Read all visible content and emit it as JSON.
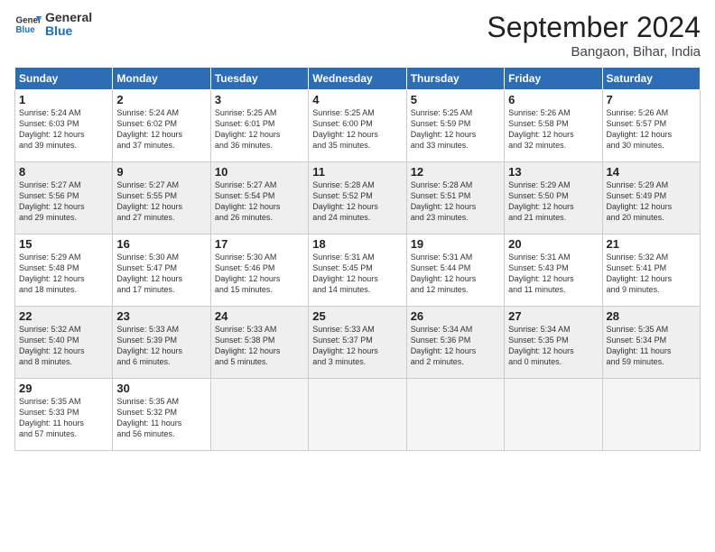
{
  "header": {
    "logo_line1": "General",
    "logo_line2": "Blue",
    "title": "September 2024",
    "location": "Bangaon, Bihar, India"
  },
  "weekdays": [
    "Sunday",
    "Monday",
    "Tuesday",
    "Wednesday",
    "Thursday",
    "Friday",
    "Saturday"
  ],
  "weeks": [
    [
      {
        "day": "1",
        "lines": [
          "Sunrise: 5:24 AM",
          "Sunset: 6:03 PM",
          "Daylight: 12 hours",
          "and 39 minutes."
        ]
      },
      {
        "day": "2",
        "lines": [
          "Sunrise: 5:24 AM",
          "Sunset: 6:02 PM",
          "Daylight: 12 hours",
          "and 37 minutes."
        ]
      },
      {
        "day": "3",
        "lines": [
          "Sunrise: 5:25 AM",
          "Sunset: 6:01 PM",
          "Daylight: 12 hours",
          "and 36 minutes."
        ]
      },
      {
        "day": "4",
        "lines": [
          "Sunrise: 5:25 AM",
          "Sunset: 6:00 PM",
          "Daylight: 12 hours",
          "and 35 minutes."
        ]
      },
      {
        "day": "5",
        "lines": [
          "Sunrise: 5:25 AM",
          "Sunset: 5:59 PM",
          "Daylight: 12 hours",
          "and 33 minutes."
        ]
      },
      {
        "day": "6",
        "lines": [
          "Sunrise: 5:26 AM",
          "Sunset: 5:58 PM",
          "Daylight: 12 hours",
          "and 32 minutes."
        ]
      },
      {
        "day": "7",
        "lines": [
          "Sunrise: 5:26 AM",
          "Sunset: 5:57 PM",
          "Daylight: 12 hours",
          "and 30 minutes."
        ]
      }
    ],
    [
      {
        "day": "8",
        "lines": [
          "Sunrise: 5:27 AM",
          "Sunset: 5:56 PM",
          "Daylight: 12 hours",
          "and 29 minutes."
        ]
      },
      {
        "day": "9",
        "lines": [
          "Sunrise: 5:27 AM",
          "Sunset: 5:55 PM",
          "Daylight: 12 hours",
          "and 27 minutes."
        ]
      },
      {
        "day": "10",
        "lines": [
          "Sunrise: 5:27 AM",
          "Sunset: 5:54 PM",
          "Daylight: 12 hours",
          "and 26 minutes."
        ]
      },
      {
        "day": "11",
        "lines": [
          "Sunrise: 5:28 AM",
          "Sunset: 5:52 PM",
          "Daylight: 12 hours",
          "and 24 minutes."
        ]
      },
      {
        "day": "12",
        "lines": [
          "Sunrise: 5:28 AM",
          "Sunset: 5:51 PM",
          "Daylight: 12 hours",
          "and 23 minutes."
        ]
      },
      {
        "day": "13",
        "lines": [
          "Sunrise: 5:29 AM",
          "Sunset: 5:50 PM",
          "Daylight: 12 hours",
          "and 21 minutes."
        ]
      },
      {
        "day": "14",
        "lines": [
          "Sunrise: 5:29 AM",
          "Sunset: 5:49 PM",
          "Daylight: 12 hours",
          "and 20 minutes."
        ]
      }
    ],
    [
      {
        "day": "15",
        "lines": [
          "Sunrise: 5:29 AM",
          "Sunset: 5:48 PM",
          "Daylight: 12 hours",
          "and 18 minutes."
        ]
      },
      {
        "day": "16",
        "lines": [
          "Sunrise: 5:30 AM",
          "Sunset: 5:47 PM",
          "Daylight: 12 hours",
          "and 17 minutes."
        ]
      },
      {
        "day": "17",
        "lines": [
          "Sunrise: 5:30 AM",
          "Sunset: 5:46 PM",
          "Daylight: 12 hours",
          "and 15 minutes."
        ]
      },
      {
        "day": "18",
        "lines": [
          "Sunrise: 5:31 AM",
          "Sunset: 5:45 PM",
          "Daylight: 12 hours",
          "and 14 minutes."
        ]
      },
      {
        "day": "19",
        "lines": [
          "Sunrise: 5:31 AM",
          "Sunset: 5:44 PM",
          "Daylight: 12 hours",
          "and 12 minutes."
        ]
      },
      {
        "day": "20",
        "lines": [
          "Sunrise: 5:31 AM",
          "Sunset: 5:43 PM",
          "Daylight: 12 hours",
          "and 11 minutes."
        ]
      },
      {
        "day": "21",
        "lines": [
          "Sunrise: 5:32 AM",
          "Sunset: 5:41 PM",
          "Daylight: 12 hours",
          "and 9 minutes."
        ]
      }
    ],
    [
      {
        "day": "22",
        "lines": [
          "Sunrise: 5:32 AM",
          "Sunset: 5:40 PM",
          "Daylight: 12 hours",
          "and 8 minutes."
        ]
      },
      {
        "day": "23",
        "lines": [
          "Sunrise: 5:33 AM",
          "Sunset: 5:39 PM",
          "Daylight: 12 hours",
          "and 6 minutes."
        ]
      },
      {
        "day": "24",
        "lines": [
          "Sunrise: 5:33 AM",
          "Sunset: 5:38 PM",
          "Daylight: 12 hours",
          "and 5 minutes."
        ]
      },
      {
        "day": "25",
        "lines": [
          "Sunrise: 5:33 AM",
          "Sunset: 5:37 PM",
          "Daylight: 12 hours",
          "and 3 minutes."
        ]
      },
      {
        "day": "26",
        "lines": [
          "Sunrise: 5:34 AM",
          "Sunset: 5:36 PM",
          "Daylight: 12 hours",
          "and 2 minutes."
        ]
      },
      {
        "day": "27",
        "lines": [
          "Sunrise: 5:34 AM",
          "Sunset: 5:35 PM",
          "Daylight: 12 hours",
          "and 0 minutes."
        ]
      },
      {
        "day": "28",
        "lines": [
          "Sunrise: 5:35 AM",
          "Sunset: 5:34 PM",
          "Daylight: 11 hours",
          "and 59 minutes."
        ]
      }
    ],
    [
      {
        "day": "29",
        "lines": [
          "Sunrise: 5:35 AM",
          "Sunset: 5:33 PM",
          "Daylight: 11 hours",
          "and 57 minutes."
        ]
      },
      {
        "day": "30",
        "lines": [
          "Sunrise: 5:35 AM",
          "Sunset: 5:32 PM",
          "Daylight: 11 hours",
          "and 56 minutes."
        ]
      },
      null,
      null,
      null,
      null,
      null
    ]
  ]
}
